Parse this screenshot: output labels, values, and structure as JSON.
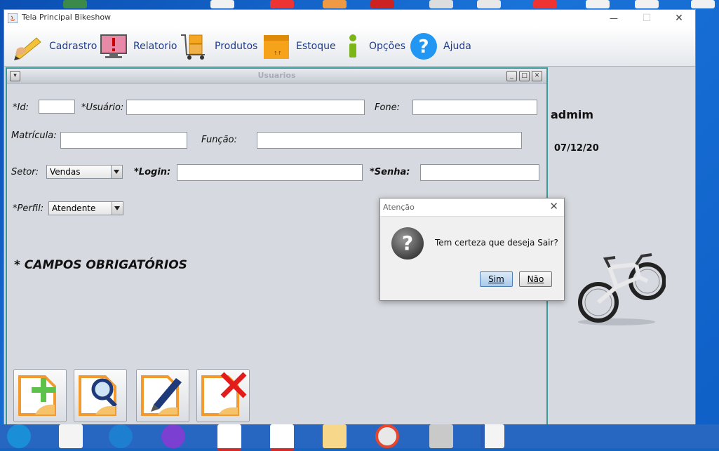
{
  "window": {
    "title": "Tela Principal Bikeshow",
    "close_glyph": "✕",
    "maximize_glyph": "☐",
    "minimize_glyph": "—"
  },
  "menu": [
    {
      "label": "Cadrastro",
      "icon": "pencil-icon"
    },
    {
      "label": "Relatorio",
      "icon": "monitor-alert-icon"
    },
    {
      "label": "Produtos",
      "icon": "cart-icon"
    },
    {
      "label": "Estoque",
      "icon": "box-icon"
    },
    {
      "label": "Opções",
      "icon": "info-icon"
    },
    {
      "label": "Ajuda",
      "icon": "help-icon"
    }
  ],
  "form": {
    "title": "Usuarios",
    "labels": {
      "id": "*Id:",
      "usuario": "*Usuário:",
      "fone": "Fone:",
      "matricula": "Matrícula:",
      "funcao": "Função:",
      "setor": "Setor:",
      "login": "*Login:",
      "senha": "*Senha:",
      "perfil": "*Perfil:"
    },
    "values": {
      "id": "",
      "usuario": "",
      "fone": "",
      "matricula": "",
      "funcao": "",
      "login": "",
      "senha": ""
    },
    "setor_selected": "Vendas",
    "perfil_selected": "Atendente",
    "required_note": "*  CAMPOS OBRIGATÓRIOS",
    "actions": [
      "add-icon",
      "search-icon",
      "edit-icon",
      "delete-icon"
    ]
  },
  "side": {
    "user": "admim",
    "date": "07/12/20"
  },
  "dialog": {
    "title": "Atenção",
    "message": "Tem certeza que deseja Sair?",
    "yes": "Sim",
    "no": "Não",
    "close_glyph": "✕"
  },
  "colors": {
    "accent": "#1f3a8a",
    "frame": "#3a9b9a",
    "desktop": "#1565c0"
  }
}
